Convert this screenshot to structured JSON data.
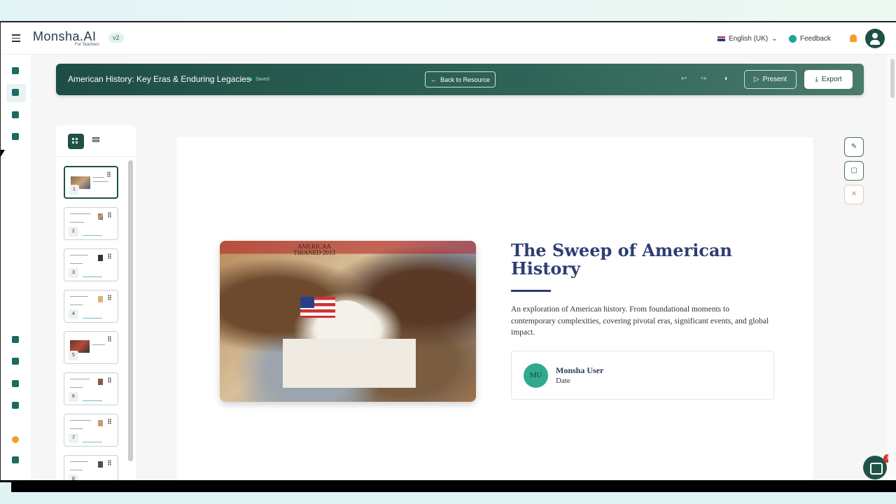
{
  "app": {
    "brand": "Monsha.AI",
    "brand_sub": "For Teachers",
    "version": "v2",
    "language": "English (UK)",
    "feedback": "Feedback"
  },
  "toolbar": {
    "doc_title": "American History: Key Eras & Enduring Legacies",
    "saved_status": "Saved",
    "back_label": "Back to Resource",
    "present_label": "Present",
    "export_label": "Export"
  },
  "slides_panel": {
    "thumbnails": [
      {
        "number": "1",
        "selected": true
      },
      {
        "number": "2"
      },
      {
        "number": "3"
      },
      {
        "number": "4"
      },
      {
        "number": "5"
      },
      {
        "number": "6"
      },
      {
        "number": "7"
      },
      {
        "number": "8"
      }
    ]
  },
  "slide": {
    "image_banner": "AMERICAA\nTIRANED 2013",
    "title": "The Sweep of American History",
    "description": "An exploration of American history. From foundational moments to contemporary complexities, covering pivotal eras, significant events, and global impact.",
    "author_initials": "MU",
    "author_name": "Monsha User",
    "author_date": "Date"
  },
  "chat": {
    "badge_count": "1"
  },
  "colors": {
    "brand_dark": "#1f5147",
    "accent_teal": "#2faa8c",
    "title_navy": "#2e3e72"
  }
}
